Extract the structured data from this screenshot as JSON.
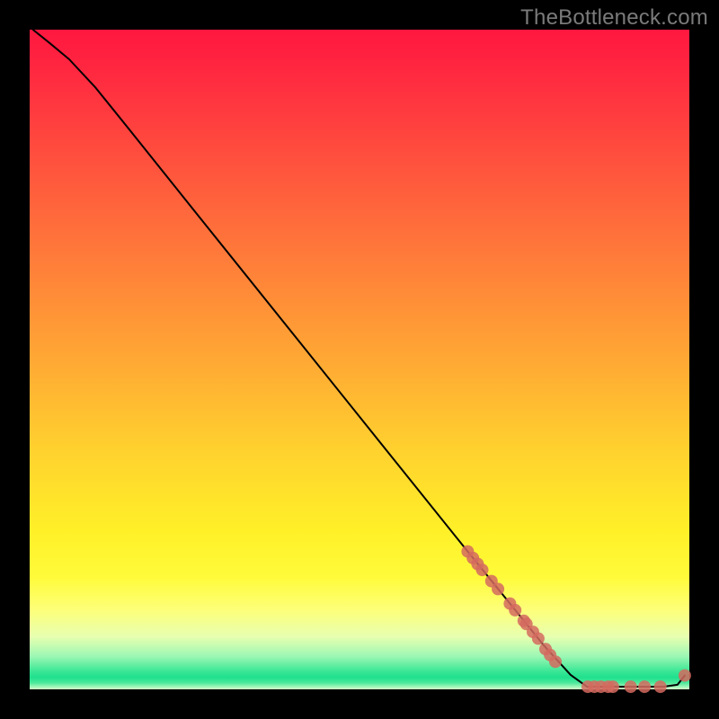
{
  "watermark": "TheBottleneck.com",
  "chart_data": {
    "type": "line",
    "title": "",
    "xlabel": "",
    "ylabel": "",
    "xlim": [
      0,
      100
    ],
    "ylim": [
      0,
      100
    ],
    "grid": false,
    "series": [
      {
        "name": "curve",
        "style": "line",
        "color": "#000000",
        "points": [
          {
            "x": 0.5,
            "y": 100
          },
          {
            "x": 3,
            "y": 98
          },
          {
            "x": 6,
            "y": 95.5
          },
          {
            "x": 10,
            "y": 91.2
          },
          {
            "x": 15,
            "y": 85
          },
          {
            "x": 25,
            "y": 72.5
          },
          {
            "x": 40,
            "y": 53.8
          },
          {
            "x": 55,
            "y": 35.1
          },
          {
            "x": 66,
            "y": 21.4
          },
          {
            "x": 72,
            "y": 14
          },
          {
            "x": 78,
            "y": 6.6
          },
          {
            "x": 82,
            "y": 2.2
          },
          {
            "x": 84.5,
            "y": 0.4
          },
          {
            "x": 90,
            "y": 0.4
          },
          {
            "x": 96,
            "y": 0.4
          },
          {
            "x": 98.2,
            "y": 0.7
          },
          {
            "x": 99.3,
            "y": 2.1
          }
        ]
      },
      {
        "name": "markers",
        "style": "scatter",
        "color": "#d46a5f",
        "points": [
          {
            "x": 66.4,
            "y": 20.9
          },
          {
            "x": 67.2,
            "y": 19.9
          },
          {
            "x": 67.9,
            "y": 19.0
          },
          {
            "x": 68.6,
            "y": 18.1
          },
          {
            "x": 70.0,
            "y": 16.4
          },
          {
            "x": 71.0,
            "y": 15.2
          },
          {
            "x": 72.8,
            "y": 13.0
          },
          {
            "x": 73.6,
            "y": 12.0
          },
          {
            "x": 74.9,
            "y": 10.4
          },
          {
            "x": 75.3,
            "y": 9.9
          },
          {
            "x": 76.3,
            "y": 8.7
          },
          {
            "x": 77.1,
            "y": 7.7
          },
          {
            "x": 78.2,
            "y": 6.1
          },
          {
            "x": 78.9,
            "y": 5.2
          },
          {
            "x": 79.7,
            "y": 4.2
          },
          {
            "x": 84.6,
            "y": 0.4
          },
          {
            "x": 85.6,
            "y": 0.4
          },
          {
            "x": 86.6,
            "y": 0.4
          },
          {
            "x": 87.7,
            "y": 0.4
          },
          {
            "x": 88.4,
            "y": 0.4
          },
          {
            "x": 91.1,
            "y": 0.4
          },
          {
            "x": 93.2,
            "y": 0.4
          },
          {
            "x": 95.6,
            "y": 0.4
          },
          {
            "x": 99.3,
            "y": 2.1
          }
        ]
      }
    ]
  }
}
